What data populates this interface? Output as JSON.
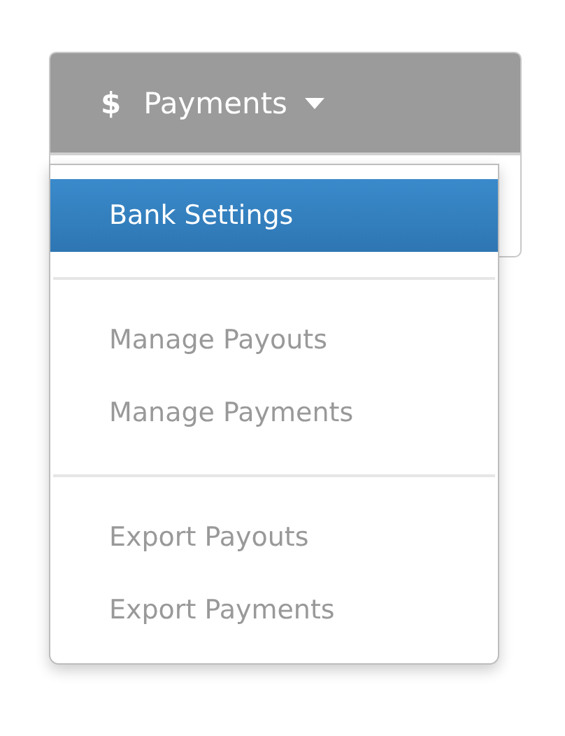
{
  "menu_button": {
    "icon_text": "$",
    "label": "Payments"
  },
  "menu": {
    "sections": [
      {
        "items": [
          {
            "label": "Bank Settings",
            "selected": true
          }
        ]
      },
      {
        "items": [
          {
            "label": "Manage Payouts",
            "selected": false
          },
          {
            "label": "Manage Payments",
            "selected": false
          }
        ]
      },
      {
        "items": [
          {
            "label": "Export Payouts",
            "selected": false
          },
          {
            "label": "Export Payments",
            "selected": false
          }
        ]
      }
    ]
  }
}
